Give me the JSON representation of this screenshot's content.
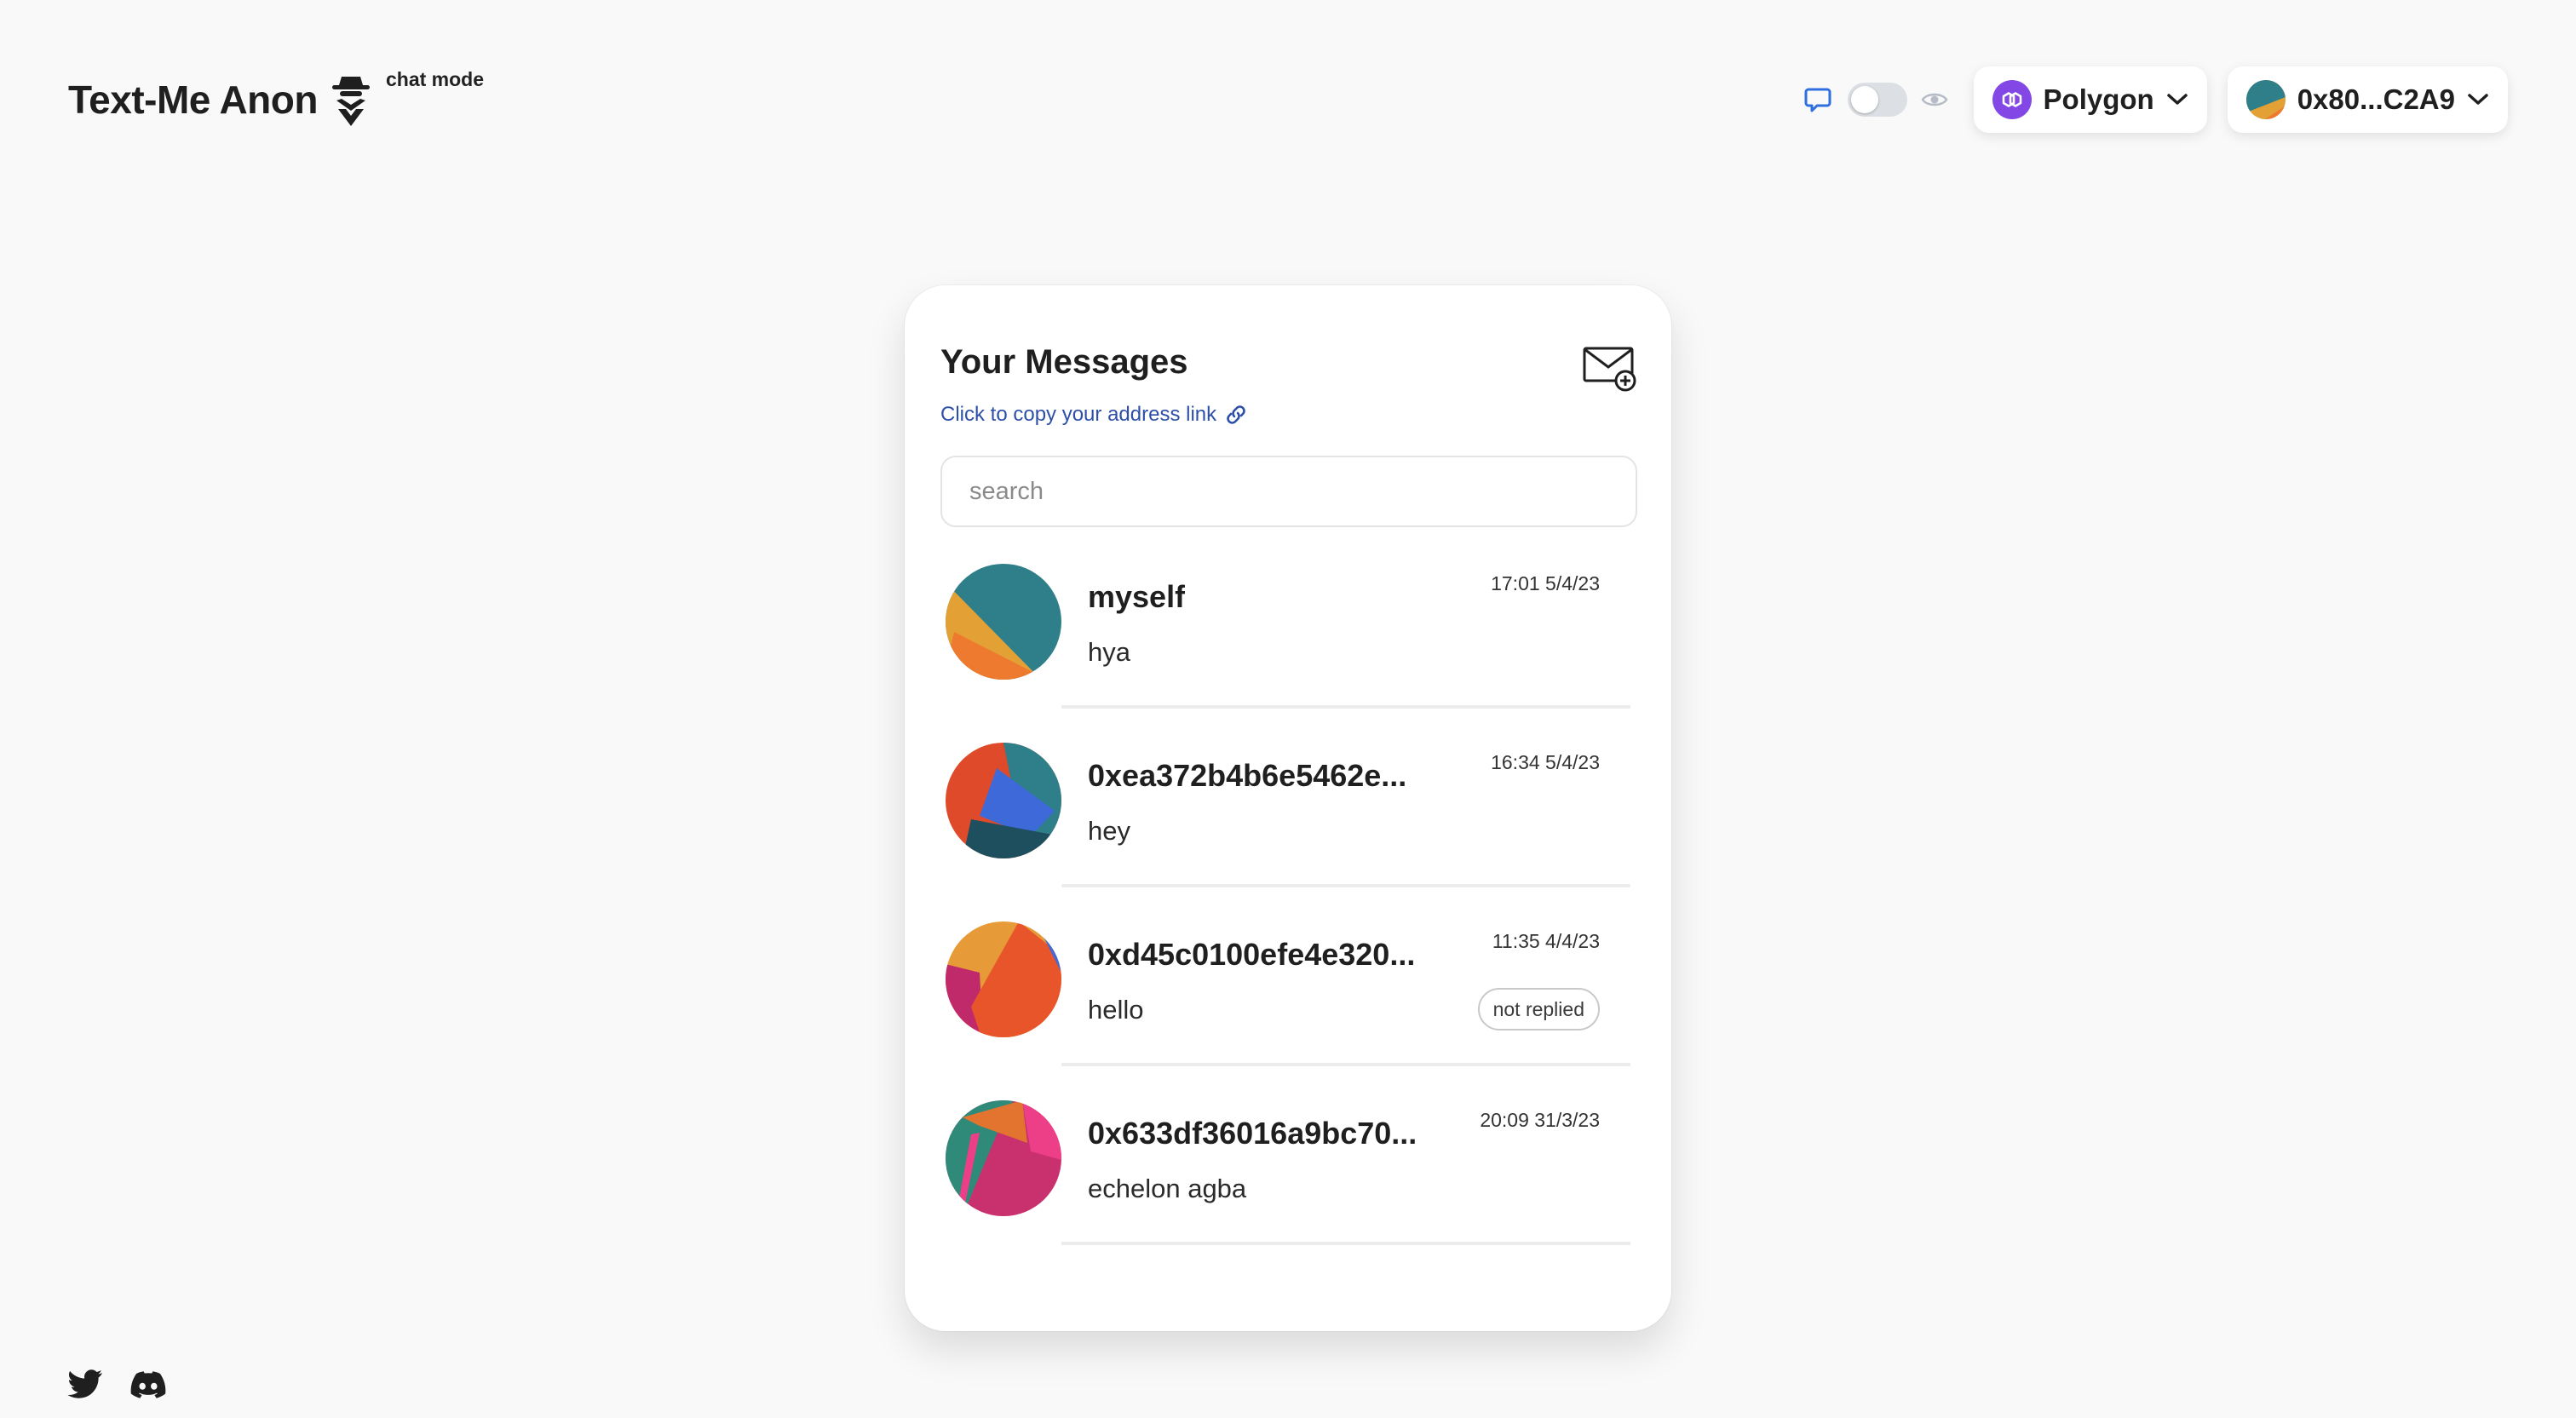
{
  "app": {
    "title": "Text-Me Anon",
    "mode_label": "chat mode"
  },
  "header": {
    "network": {
      "label": "Polygon",
      "logo_color": "#8247e5"
    },
    "account": {
      "label": "0x80...C2A9"
    },
    "mode_toggle": {
      "left_icon": "chat-bubble-icon",
      "right_icon": "eye-icon",
      "state": "off"
    }
  },
  "messages_panel": {
    "title": "Your Messages",
    "copy_link_label": "Click to copy your address link",
    "search": {
      "placeholder": "search",
      "value": ""
    },
    "items": [
      {
        "name": "myself",
        "time": "17:01 5/4/23",
        "preview": "hya",
        "badge": ""
      },
      {
        "name": "0xea372b4b6e5462e...",
        "time": "16:34 5/4/23",
        "preview": "hey",
        "badge": ""
      },
      {
        "name": "0xd45c0100efe4e320...",
        "time": "11:35 4/4/23",
        "preview": "hello",
        "badge": "not replied"
      },
      {
        "name": "0x633df36016a9bc70...",
        "time": "20:09 31/3/23",
        "preview": "echelon agba",
        "badge": ""
      }
    ]
  },
  "footer": {
    "social_icons": [
      "twitter-icon",
      "discord-icon"
    ]
  },
  "colors": {
    "background": "#f9f9f9",
    "link": "#2d4fa8",
    "toggle_accent": "#2f6fe0"
  }
}
